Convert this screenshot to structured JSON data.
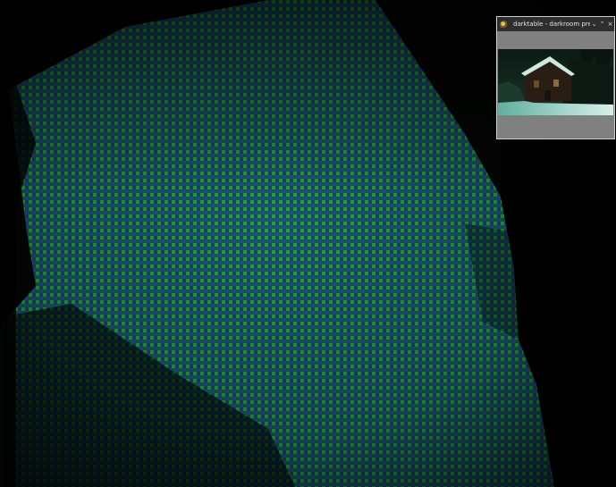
{
  "preview_window": {
    "title": "darktable - darkroom preview",
    "app_icon": "darktable-icon",
    "controls": {
      "minimize": "⌄",
      "maximize": "⌃",
      "close": "×"
    }
  },
  "colors": {
    "checker_green": "#17a84a",
    "checker_blue": "#1d4bb0",
    "dark_background": "#050805",
    "preview_gray": "#808080",
    "titlebar_bg": "#2e2e2e"
  }
}
